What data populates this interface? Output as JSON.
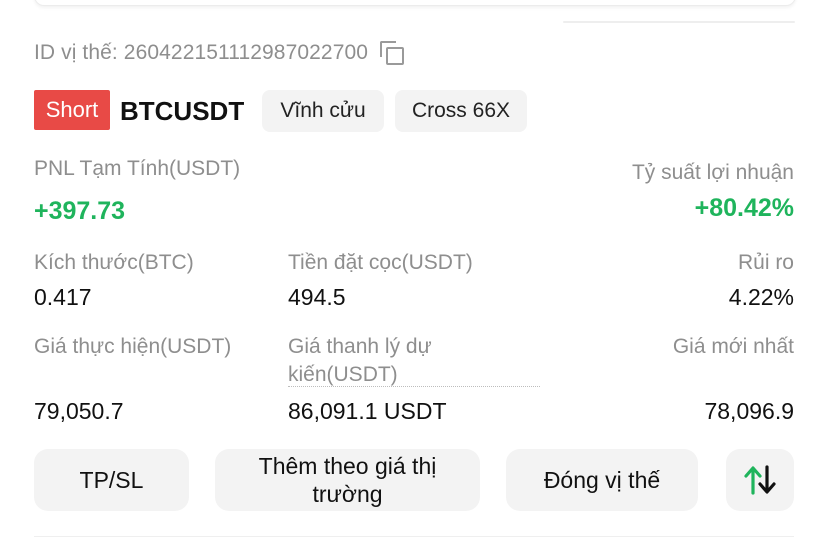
{
  "position": {
    "id_text": "ID vị thế: 2604221511129870227​00",
    "side": "Short",
    "symbol": "BTCUSDT",
    "contract_type": "Vĩnh cửu",
    "margin_mode": "Cross 66X"
  },
  "pnl": {
    "label": "PNL Tạm Tính(USDT)",
    "value": "+397.73",
    "roi_label": "Tỷ suất lợi nhuận",
    "roi_value": "+80.42%"
  },
  "details": {
    "size_label": "Kích thước(BTC)",
    "size_value": "0.417",
    "margin_label": "Tiền đặt cọc(USDT)",
    "margin_value": "494.5",
    "risk_label": "Rủi ro",
    "risk_value": "4.22%",
    "entry_label": "Giá thực hiện(USDT)",
    "entry_value": "79,050.7",
    "liq_label_line1": "Giá thanh lý dự",
    "liq_label_line2": "kiến(USDT)",
    "liq_value": "86,091.1 USDT",
    "mark_label": "Giá mới nhất",
    "mark_value": "78,096.9"
  },
  "actions": {
    "tpsl": "TP/SL",
    "add_line1": "Thêm theo giá thị",
    "add_line2": "trường",
    "close": "Đóng vị thế"
  },
  "colors": {
    "short_badge": "#e84a46",
    "profit_green": "#1fb45c",
    "swap_up_arrow": "#1fb45c",
    "swap_down_arrow": "#111111"
  },
  "icons": {
    "copy": "copy-icon",
    "swap": "swap-vertical-icon"
  }
}
